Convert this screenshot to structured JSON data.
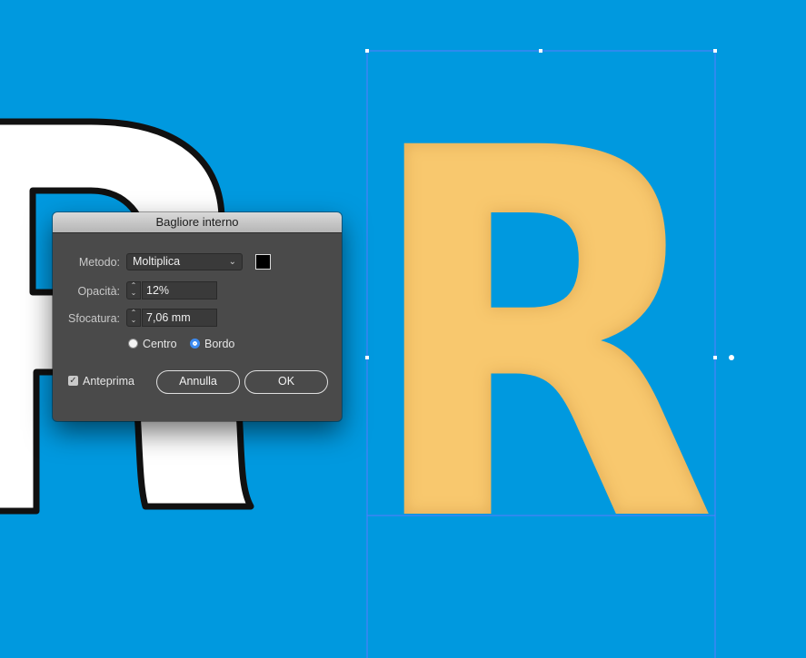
{
  "dialog": {
    "title": "Bagliore interno",
    "metodo": {
      "label": "Metodo:",
      "value": "Moltiplica",
      "swatch_color": "#000000"
    },
    "opacita": {
      "label": "Opacità:",
      "value": "12%"
    },
    "sfocatura": {
      "label": "Sfocatura:",
      "value": "7,06 mm"
    },
    "radios": [
      {
        "label": "Centro",
        "selected": false
      },
      {
        "label": "Bordo",
        "selected": true
      }
    ],
    "preview": {
      "label": "Anteprima",
      "checked": true
    },
    "buttons": {
      "cancel": "Annulla",
      "ok": "OK"
    }
  },
  "canvas": {
    "background_color": "#0099DF",
    "letter": "R",
    "letter_fill_color": "#F8C86E",
    "outline_letter_fill": "#FFFFFF",
    "selection_color": "#5B7BFF"
  }
}
